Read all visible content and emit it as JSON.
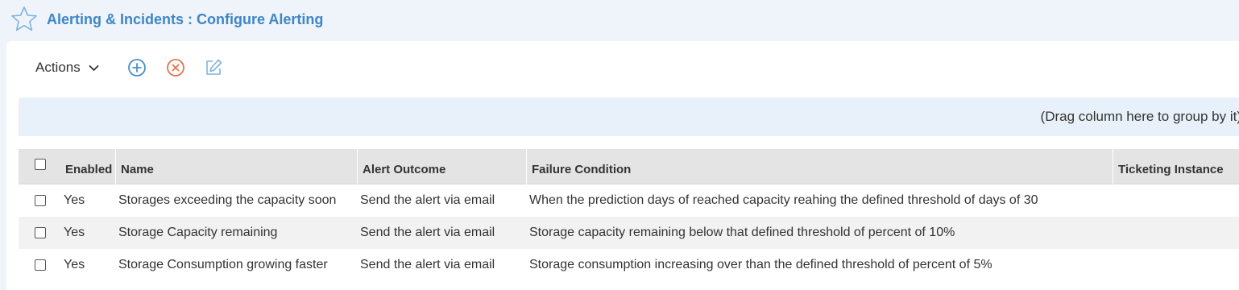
{
  "header": {
    "title": "Alerting & Incidents : Configure Alerting"
  },
  "toolbar": {
    "actions_label": "Actions",
    "icons": [
      "add-icon",
      "delete-icon",
      "edit-icon"
    ]
  },
  "groupbar": {
    "text": "(Drag column here to group by it)"
  },
  "grid": {
    "columns": [
      "Enabled",
      "Name",
      "Alert Outcome",
      "Failure Condition",
      "Ticketing Instance"
    ],
    "rows": [
      {
        "enabled": "Yes",
        "name": "Storages exceeding the capacity soon",
        "outcome": "Send the alert via email",
        "condition": "When the prediction days of reached capacity reahing the defined threshold of days of 30",
        "ticketing": ""
      },
      {
        "enabled": "Yes",
        "name": "Storage Capacity remaining",
        "outcome": "Send the alert via email",
        "condition": "Storage capacity remaining below that defined threshold of percent of 10%",
        "ticketing": ""
      },
      {
        "enabled": "Yes",
        "name": "Storage Consumption growing faster",
        "outcome": "Send the alert via email",
        "condition": "Storage consumption increasing over than the defined threshold of percent of 5%",
        "ticketing": ""
      }
    ]
  },
  "colors": {
    "title": "#3e86c6",
    "add": "#4a90c8",
    "delete": "#e8744a",
    "edit": "#7fb3de",
    "background": "#eef4fa"
  }
}
